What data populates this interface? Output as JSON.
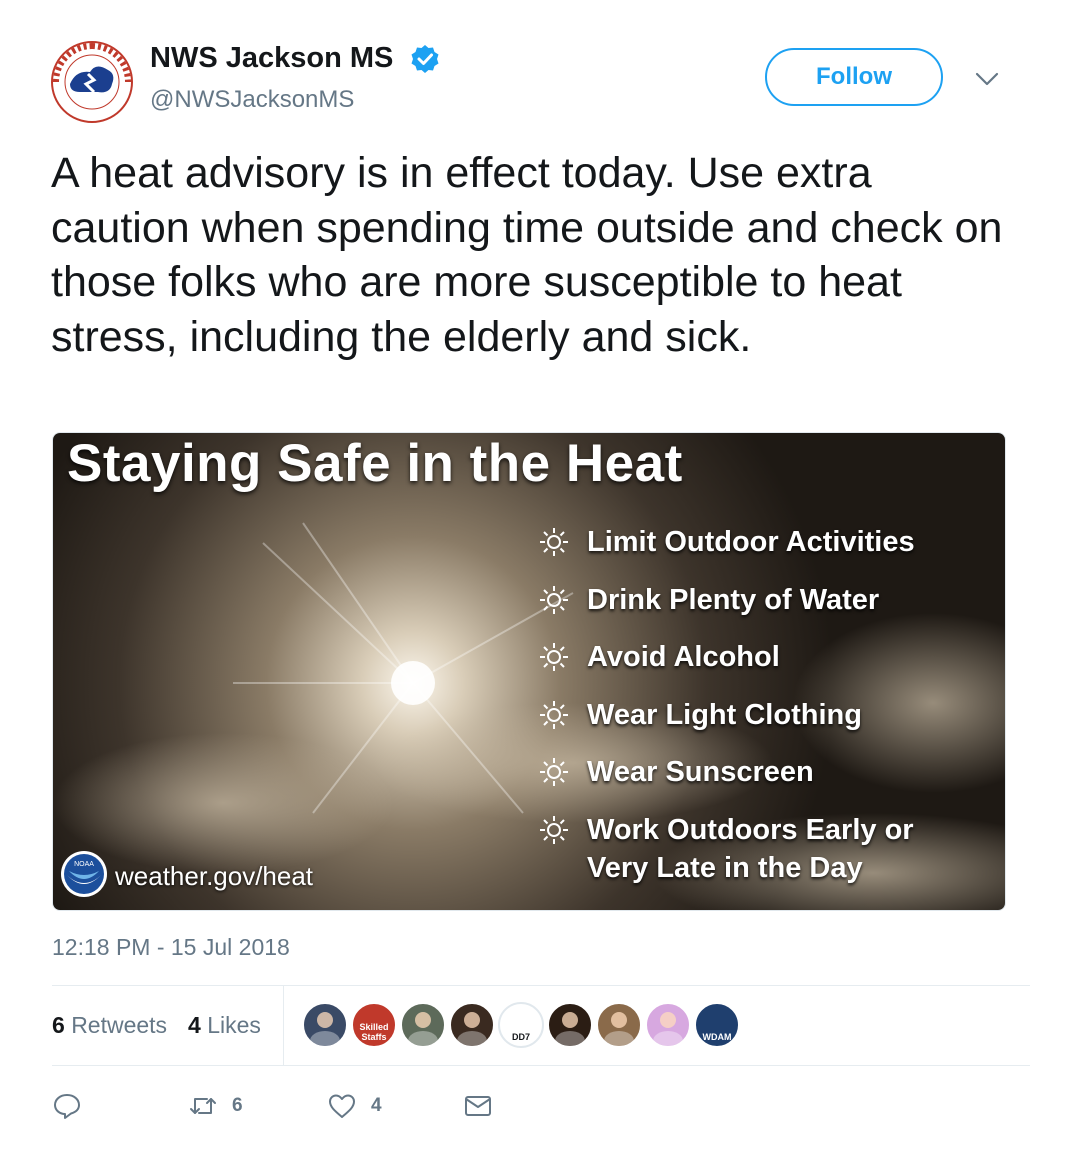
{
  "author": {
    "name": "NWS Jackson MS",
    "handle": "@NWSJacksonMS",
    "verified": true,
    "avatar_icon": "nws-logo"
  },
  "follow_label": "Follow",
  "tweet_text": "A heat advisory is in effect today. Use extra caution when spending time outside and check on those folks who are more susceptible to heat stress, including the elderly and sick.",
  "image": {
    "title": "Staying Safe in the Heat",
    "tips": [
      "Limit Outdoor Activities",
      "Drink Plenty of Water",
      "Avoid Alcohol",
      "Wear Light Clothing",
      "Wear Sunscreen"
    ],
    "last_tip_line1": "Work Outdoors Early or",
    "last_tip_line2": "Very Late in the Day",
    "logo_text": "NOAA",
    "site": "weather.gov/heat"
  },
  "timestamp": "12:18 PM - 15 Jul 2018",
  "stats": {
    "retweets_count": "6",
    "retweets_label": "Retweets",
    "likes_count": "4",
    "likes_label": "Likes"
  },
  "likers": [
    {
      "icon": "avatar-1",
      "color": "#3a4a66"
    },
    {
      "icon": "avatar-2",
      "color": "#c0392b",
      "label": "Skilled Staffs"
    },
    {
      "icon": "avatar-3",
      "color": "#5d6a5a"
    },
    {
      "icon": "avatar-4",
      "color": "#3a2a20"
    },
    {
      "icon": "avatar-5",
      "color": "#ffffff",
      "label": "DD7"
    },
    {
      "icon": "avatar-6",
      "color": "#2b1d14"
    },
    {
      "icon": "avatar-7",
      "color": "#8a6a4a"
    },
    {
      "icon": "avatar-8",
      "color": "#d7a8e0"
    },
    {
      "icon": "avatar-9",
      "color": "#1f3f6e",
      "label": "WDAM"
    }
  ],
  "actions": {
    "reply_count": "",
    "retweet_count": "6",
    "like_count": "4"
  },
  "colors": {
    "accent": "#1da1f2",
    "text": "#14171a",
    "muted": "#657786",
    "border": "#e6ecf0"
  }
}
